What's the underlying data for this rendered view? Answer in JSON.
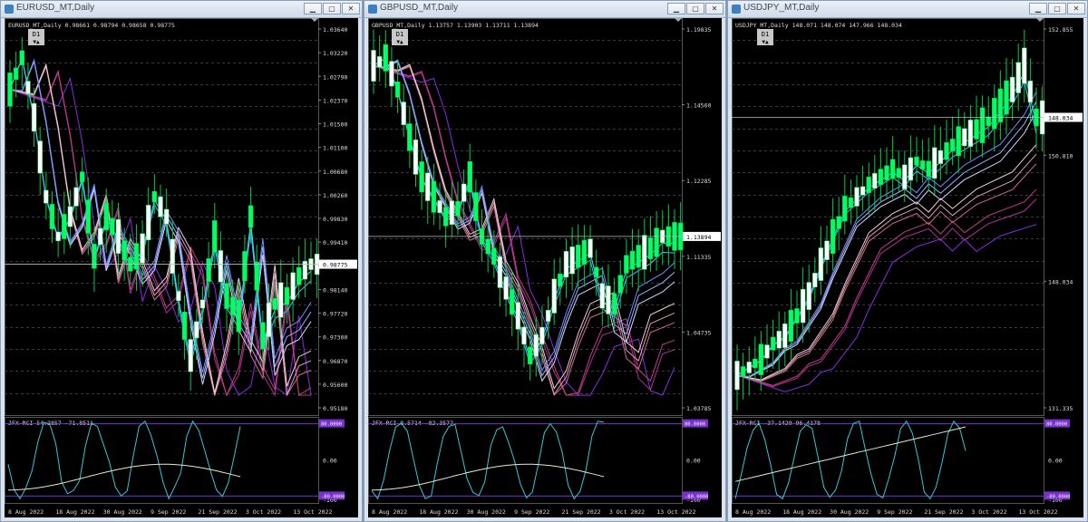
{
  "windows": [
    {
      "title": "EURUSD_MT,Daily",
      "header": "EURUSD_MT,Daily  0.98661 0.98794 0.98658 0.98775",
      "timeframe": "D1",
      "indicator_label": "JFX-RCI 54.2857 -71.8511",
      "price_ticks": [
        "1.03640",
        "1.03220",
        "1.02790",
        "1.02370",
        "1.01500",
        "1.01100",
        "1.00680",
        "1.00260",
        "0.99830",
        "0.99410",
        "0.98775",
        "0.98140",
        "0.97720",
        "0.97300",
        "0.96870",
        "0.95600",
        "0.95180"
      ],
      "current_price": "0.98775",
      "sub_ticks": [
        "100",
        "0.00",
        "-100"
      ],
      "level_labels": [
        "80.0000",
        "-80.0000"
      ],
      "date_labels": [
        "8 Aug 2022",
        "18 Aug 2022",
        "30 Aug 2022",
        "9 Sep 2022",
        "21 Sep 2022",
        "3 Oct 2022",
        "13 Oct 2022"
      ]
    },
    {
      "title": "GBPUSD_MT,Daily",
      "header": "GBPUSD_MT,Daily  1.13757 1.13903 1.13711 1.13894",
      "timeframe": "D1",
      "indicator_label": "JFX-RCI 8.5714 -82.3577",
      "price_ticks": [
        "1.19835",
        "1.14560",
        "1.12285",
        "1.11335",
        "1.04735",
        "1.03785"
      ],
      "current_price": "1.13894",
      "sub_ticks": [
        "100",
        "0.00",
        "-100"
      ],
      "level_labels": [
        "80.0000",
        "-80.0000"
      ],
      "date_labels": [
        "8 Aug 2022",
        "18 Aug 2022",
        "30 Aug 2022",
        "9 Sep 2022",
        "21 Sep 2022",
        "3 Oct 2022",
        "13 Oct 2022"
      ]
    },
    {
      "title": "USDJPY_MT,Daily",
      "header": "USDJPY_MT,Daily  148.071 148.074 147.966 148.034",
      "timeframe": "D1",
      "indicator_label": "JFX-RCI -37.1429 96.4178",
      "price_ticks": [
        "152.855",
        "150.810",
        "148.034",
        "131.335"
      ],
      "current_price": "148.034",
      "sub_ticks": [
        "100",
        "0.00",
        "-100"
      ],
      "level_labels": [
        "80.0000",
        "-80.0000"
      ],
      "date_labels": [
        "8 Aug 2022",
        "18 Aug 2022",
        "30 Aug 2022",
        "9 Sep 2022",
        "21 Sep 2022",
        "3 Oct 2022",
        "13 Oct 2022"
      ]
    }
  ],
  "colors": {
    "bull": "#00ff66",
    "bear": "#ffffff",
    "wick": "#00cc44",
    "rci_fast": "#33c8d8",
    "rci_slow": "#e8e8d0",
    "level_box": "#7a2fd0"
  },
  "window_buttons": [
    "minimize",
    "maximize",
    "close"
  ]
}
